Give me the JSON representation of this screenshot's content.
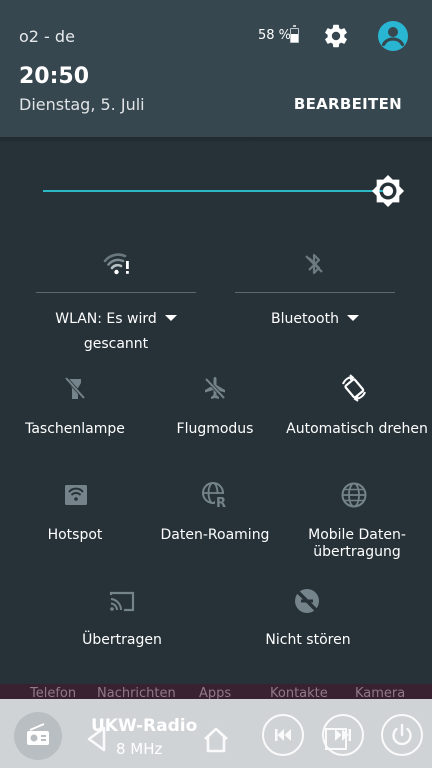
{
  "status_bar": {
    "carrier": "o2 - de",
    "battery_text": "58 %",
    "battery_level": 0.58,
    "settings_icon": "gear-icon",
    "user_icon": "account-circle-icon"
  },
  "header": {
    "time": "20:50",
    "date": "Dienstag, 5. Juli",
    "edit_label": "BEARBEITEN"
  },
  "brightness": {
    "level": 1.0,
    "accent_color": "#2bb9c8"
  },
  "toggles": [
    {
      "label": "WLAN: Es wird",
      "label_line2": "gescannt",
      "icon": "wifi-icon"
    },
    {
      "label": "Bluetooth",
      "icon": "bluetooth-off-icon"
    }
  ],
  "tiles": [
    {
      "label": "Taschenlampe",
      "icon": "flashlight-off-icon"
    },
    {
      "label": "Flugmodus",
      "icon": "airplane-off-icon"
    },
    {
      "label": "Automatisch drehen",
      "icon": "auto-rotate-icon"
    },
    {
      "label": "Hotspot",
      "icon": "hotspot-icon"
    },
    {
      "label": "Daten-Roaming",
      "icon": "data-roaming-icon"
    },
    {
      "label": "Mobile Daten-",
      "label_line2": "übertragung",
      "icon": "globe-icon"
    },
    {
      "label": "Übertragen",
      "icon": "cast-icon"
    },
    {
      "label": "Nicht stören",
      "icon": "do-not-disturb-off-icon"
    }
  ],
  "dock_labels": [
    "Telefon",
    "Nachrichten",
    "Apps",
    "Kontakte",
    "Kamera"
  ],
  "radio": {
    "title": "UKW-Radio",
    "frequency": "8 MHz"
  },
  "colors": {
    "panel": "#263238",
    "header": "#37474f",
    "accent": "#2bb9c8",
    "avatar": "#29b6d2"
  }
}
